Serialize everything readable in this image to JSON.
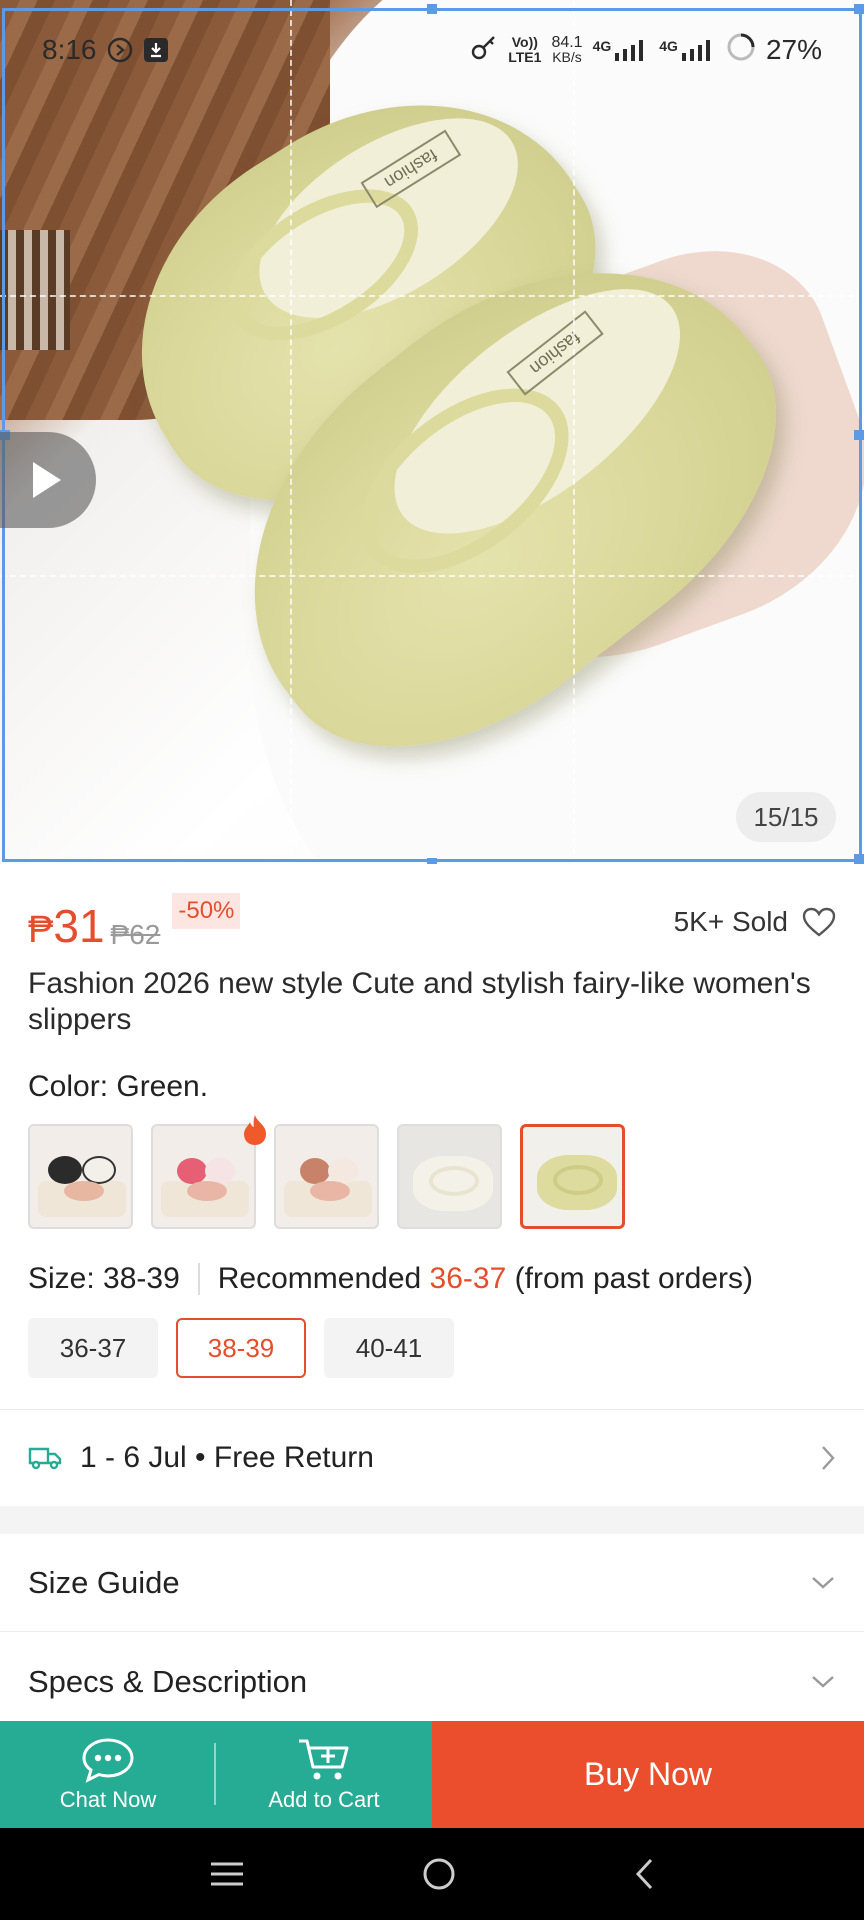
{
  "status_bar": {
    "time": "8:16",
    "net_label_top": "Vo))",
    "net_label_bottom": "LTE1",
    "speed_value": "84.1",
    "speed_unit": "KB/s",
    "signal1_label": "4G",
    "signal2_label": "4G",
    "battery": "27%"
  },
  "gallery": {
    "counter": "15/15"
  },
  "product": {
    "price_currency": "₱",
    "price": "31",
    "original_price": "₱62",
    "discount": "-50%",
    "sold": "5K+ Sold",
    "title": "Fashion 2026 new style Cute and stylish fairy-like women's slippers",
    "color_label": "Color: Green.",
    "swatch_count": 5,
    "selected_swatch_index": 4
  },
  "size": {
    "label": "Size: 38-39",
    "recommend_prefix": "Recommended",
    "recommend_value": "36-37",
    "recommend_suffix": "(from past orders)",
    "options": [
      "36-37",
      "38-39",
      "40-41"
    ],
    "selected_index": 1
  },
  "delivery": {
    "text": "1 - 6 Jul • Free Return"
  },
  "sections": {
    "size_guide": "Size Guide",
    "specs": "Specs & Description"
  },
  "actions": {
    "chat_label": "Chat Now",
    "cart_label": "Add to Cart",
    "buy_label": "Buy Now"
  },
  "colors": {
    "accent": "#e54e2c",
    "teal": "#26ab94",
    "buy": "#ea4e2c"
  }
}
